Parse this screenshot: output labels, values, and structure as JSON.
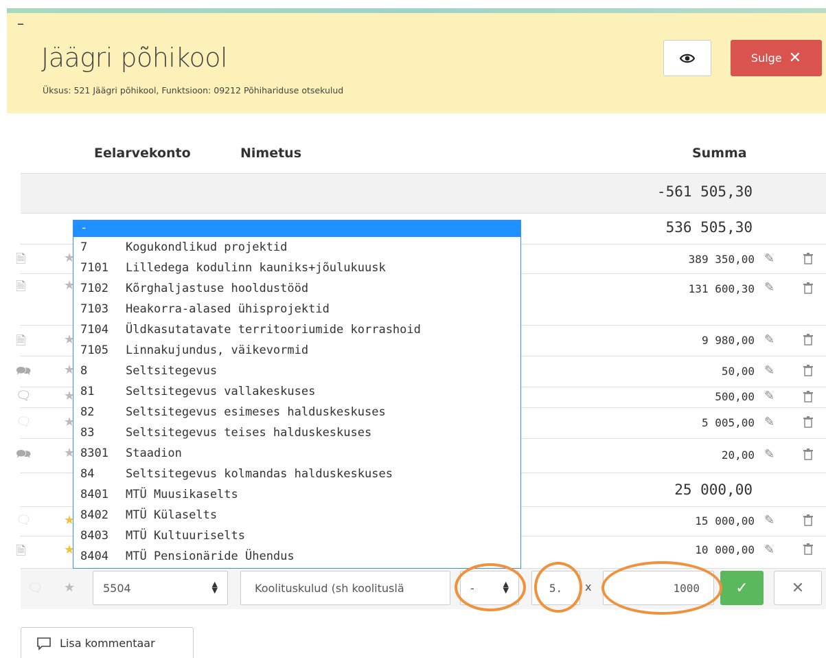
{
  "header": {
    "dash": "–",
    "title": "Jäägri põhikool",
    "subtitle": "Üksus: 521 Jäägri põhikool, Funktsioon: 09212 Põhihariduse otsekulud",
    "close_label": "Sulge",
    "eye_icon": "eye-icon",
    "close_icon": "close-icon"
  },
  "columns": {
    "account": "Eelarvekonto",
    "name": "Nimetus",
    "sum": "Summa"
  },
  "rows": [
    {
      "sum": "-561 505,30"
    },
    {
      "sum": "536 505,30"
    },
    {
      "sum": "389 350,00"
    },
    {
      "sum": "131 600,30"
    },
    {
      "sum": "9 980,00"
    },
    {
      "sum": "50,00"
    },
    {
      "sum": "500,00"
    },
    {
      "sum": "5 005,00"
    },
    {
      "sum": "20,00"
    },
    {
      "sum": "25 000,00"
    },
    {
      "sum": "15 000,00"
    },
    {
      "sum": "10 000,00"
    }
  ],
  "dropdown": {
    "selected": "-",
    "options": [
      {
        "code": "7",
        "label": "Kogukondlikud projektid"
      },
      {
        "code": "7101",
        "label": "Lilledega kodulinn kauniks+jõulukuusk"
      },
      {
        "code": "7102",
        "label": "Kõrghaljastuse hooldustööd"
      },
      {
        "code": "7103",
        "label": "Heakorra-alased ühisprojektid"
      },
      {
        "code": "7104",
        "label": "Üldkasutatavate territooriumide korrashoid"
      },
      {
        "code": "7105",
        "label": "Linnakujundus, väikevormid"
      },
      {
        "code": "8",
        "label": "Seltsitegevus"
      },
      {
        "code": "81",
        "label": "Seltsitegevus vallakeskuses"
      },
      {
        "code": "82",
        "label": "Seltsitegevus esimeses halduskeskuses"
      },
      {
        "code": "83",
        "label": "Seltsitegevus teises halduskeskuses"
      },
      {
        "code": "8301",
        "label": "Staadion"
      },
      {
        "code": "84",
        "label": "Seltsitegevus kolmandas halduskeskuses"
      },
      {
        "code": "8401",
        "label": "MTÜ Muusikaselts"
      },
      {
        "code": "8402",
        "label": "MTÜ Külaselts"
      },
      {
        "code": "8403",
        "label": "MTÜ Kultuuriselts"
      },
      {
        "code": "8404",
        "label": "MTÜ Pensionäride Ühendus"
      }
    ]
  },
  "edit": {
    "account": "5504",
    "name": "Koolituskulud (sh koolituslä",
    "project": "-",
    "quantity": "5.",
    "times": "x",
    "price": "1000"
  },
  "comment_button": "Lisa kommentaar",
  "colors": {
    "header_bg": "#fcf1b8",
    "danger": "#d9534f",
    "success": "#5cb85c",
    "select_blue": "#1e90ff",
    "annotation": "#f0913c"
  }
}
